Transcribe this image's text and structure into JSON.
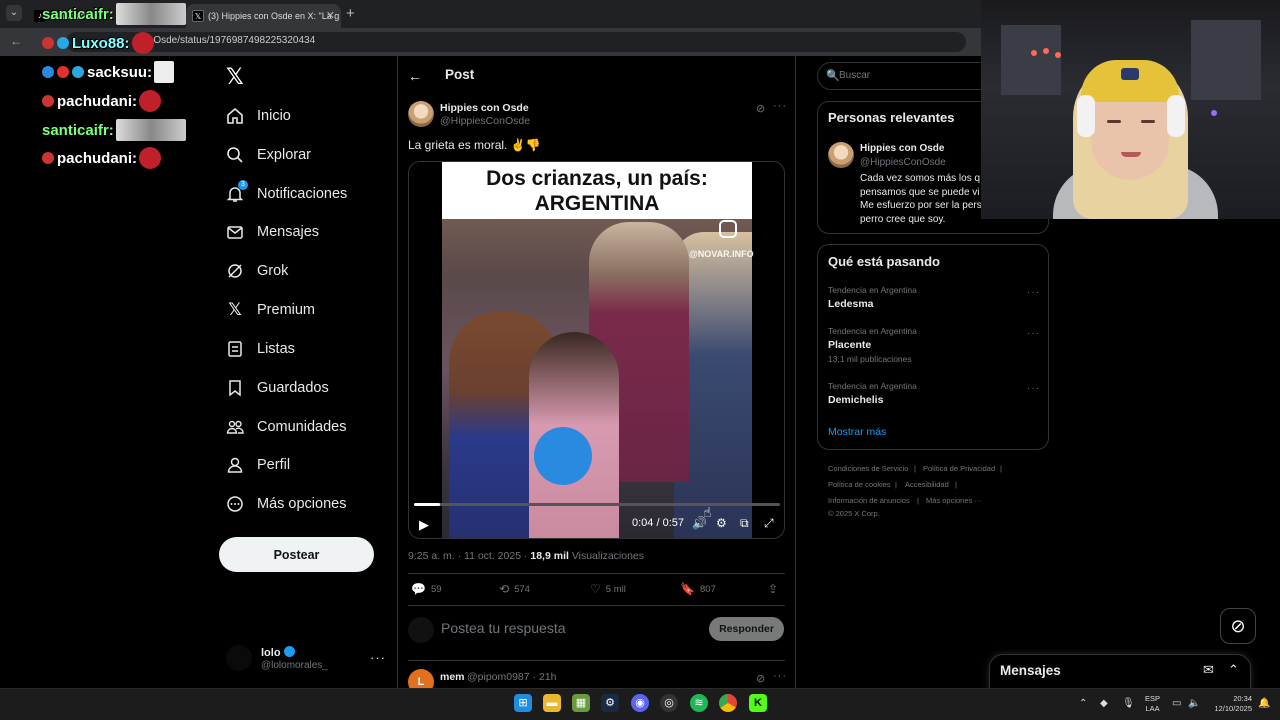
{
  "browser": {
    "tabs": [
      {
        "label": "santicaifr:",
        "active": false
      },
      {
        "label": "(3) Hippies con Osde en X: \"La g",
        "active": true
      }
    ],
    "url": "ConOsde/status/1976987498225320434"
  },
  "chat": {
    "messages": [
      {
        "user": "santicaifr:"
      },
      {
        "user": "Luxo88:"
      },
      {
        "user": "sacksuu:"
      },
      {
        "user": "pachudani:"
      },
      {
        "user": "santicaifr:"
      },
      {
        "user": "pachudani:"
      }
    ]
  },
  "nav": {
    "items": [
      {
        "label": "Inicio",
        "icon": "home-icon"
      },
      {
        "label": "Explorar",
        "icon": "search-icon"
      },
      {
        "label": "Notificaciones",
        "icon": "bell-icon",
        "badge": "3"
      },
      {
        "label": "Mensajes",
        "icon": "envelope-icon"
      },
      {
        "label": "Grok",
        "icon": "grok-icon"
      },
      {
        "label": "Premium",
        "icon": "x-icon"
      },
      {
        "label": "Listas",
        "icon": "list-icon"
      },
      {
        "label": "Guardados",
        "icon": "bookmark-icon"
      },
      {
        "label": "Comunidades",
        "icon": "people-icon"
      },
      {
        "label": "Perfil",
        "icon": "person-icon"
      },
      {
        "label": "Más opciones",
        "icon": "more-circle-icon"
      }
    ],
    "post_button": "Postear",
    "account": {
      "name": "lolo",
      "handle": "@lolomorales_"
    }
  },
  "post": {
    "header_title": "Post",
    "author": {
      "name": "Hippies con Osde",
      "handle": "@HippiesConOsde"
    },
    "text": "La grieta es moral. ✌️👎",
    "video": {
      "title_line1": "Dos crianzas, un país:",
      "title_line2": "ARGENTINA",
      "watermark": "@NOVAR.INFO",
      "time": "0:04 / 0:57",
      "progress": 0.07
    },
    "timestamp": "9:25 a. m. · 11 oct. 2025 · ",
    "views_count": "18,9 mil",
    "views_label": " Visualizaciones",
    "actions": {
      "replies": "59",
      "reposts": "574",
      "likes": "5 mil",
      "bookmarks": "807"
    },
    "reply_placeholder": "Postea tu respuesta",
    "reply_button": "Responder"
  },
  "next_reply": {
    "avatar_letter": "L",
    "name": "mem",
    "handle": "@pipom0987 · 21h"
  },
  "sidebar": {
    "search_placeholder": "Buscar",
    "relevant": {
      "title": "Personas relevantes",
      "name": "Hippies con Osde",
      "handle": "@HippiesConOsde",
      "bio_lines": [
        "Cada vez somos más los q",
        "pensamos que se puede vi",
        "Me esfuerzo por ser la pers",
        "perro cree que soy."
      ]
    },
    "trends": {
      "title": "Qué está pasando",
      "items": [
        {
          "category": "Tendencia en Argentina",
          "name": "Ledesma",
          "count": ""
        },
        {
          "category": "Tendencia en Argentina",
          "name": "Placente",
          "count": "13,1 mil publicaciones"
        },
        {
          "category": "Tendencia en Argentina",
          "name": "Demichelis",
          "count": ""
        }
      ],
      "show_more": "Mostrar más"
    },
    "footer": {
      "terms": "Condiciones de Servicio",
      "privacy": "Política de Privacidad",
      "cookies": "Política de cookies",
      "accessibility": "Accesibilidad",
      "ads": "Información de anuncios",
      "more": "Más opciones ···",
      "copyright": "© 2025 X Corp."
    }
  },
  "messages_drawer": {
    "title": "Mensajes"
  },
  "taskbar": {
    "lang_line1": "ESP",
    "lang_line2": "LAA",
    "time": "20:34",
    "date": "12/10/2025"
  },
  "colors": {
    "accent": "#1d9bf0",
    "background": "#000000",
    "text": "#e7e9ea",
    "muted": "#71767b"
  }
}
